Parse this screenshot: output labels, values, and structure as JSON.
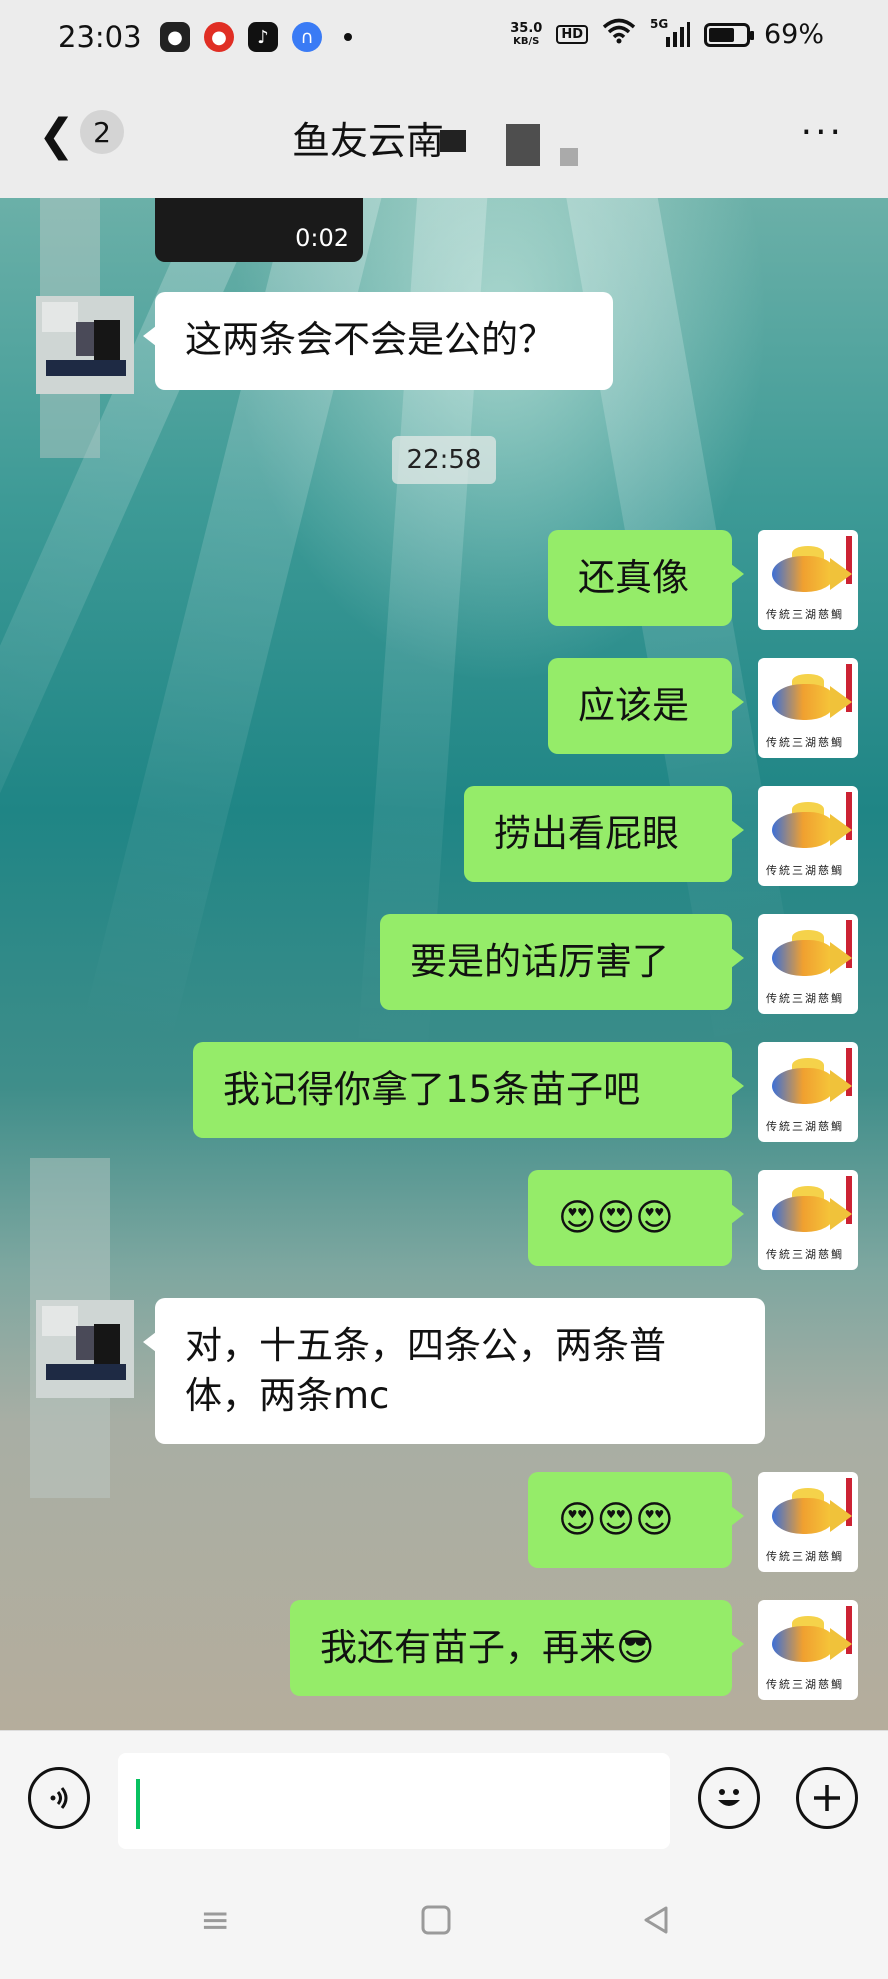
{
  "status_bar": {
    "time": "23:03",
    "net_speed_value": "35.0",
    "net_speed_unit": "KB/S",
    "hd": "HD",
    "network": "5G",
    "battery": "69%",
    "battery_level": 0.69,
    "notification_icons": [
      "wechat-icon",
      "netease-music-icon",
      "tiktok-icon",
      "baidu-netdisk-icon"
    ]
  },
  "header": {
    "back_badge": "2",
    "title": "鱼友云南",
    "more": "···"
  },
  "chat": {
    "video_duration": "0:02",
    "timestamp": "22:58",
    "messages": [
      {
        "side": "left",
        "text": "这两条会不会是公的？"
      },
      {
        "side": "right",
        "text": "还真像"
      },
      {
        "side": "right",
        "text": "应该是"
      },
      {
        "side": "right",
        "text": "捞出看屁眼"
      },
      {
        "side": "right",
        "text": "要是的话厉害了"
      },
      {
        "side": "right",
        "text": "我记得你拿了15条苗子吧"
      },
      {
        "side": "right",
        "text": "😍😍😍"
      },
      {
        "side": "left",
        "text": "对，十五条，四条公，两条普体，两条mc"
      },
      {
        "side": "right",
        "text": "😍😍😍"
      },
      {
        "side": "right",
        "text": "我还有苗子，再来😎"
      }
    ],
    "my_avatar_caption": "传統三湖慈鯛"
  },
  "input_bar": {
    "text_value": ""
  }
}
